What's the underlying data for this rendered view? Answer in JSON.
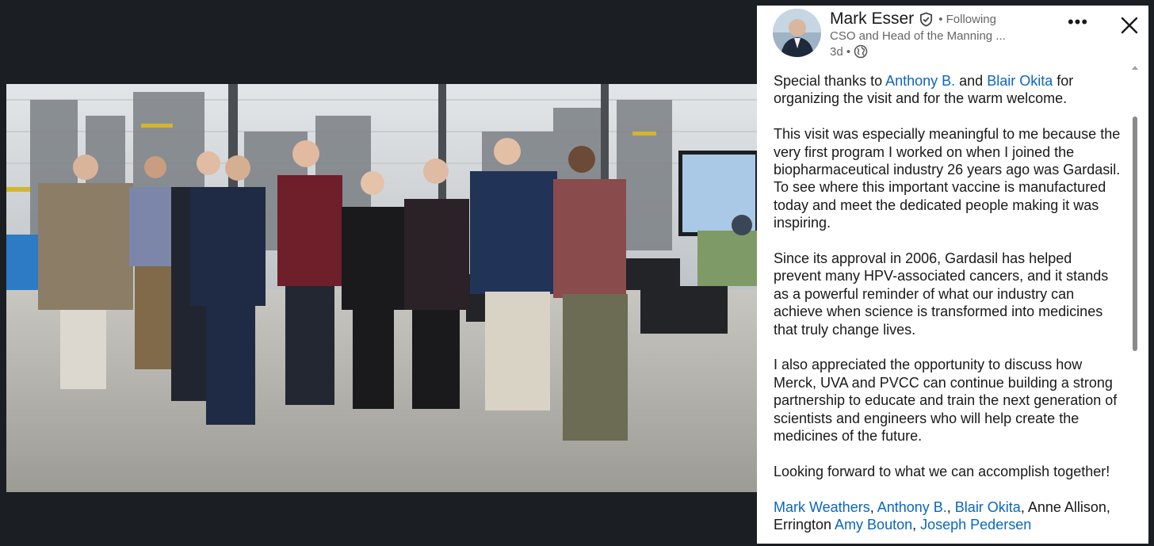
{
  "post": {
    "author": {
      "name": "Mark Esser",
      "following": "• Following",
      "headline": "CSO and Head of the Manning ...",
      "time": "3d •"
    },
    "icons": {
      "verified": "verified-shield-icon",
      "visibility": "globe-icon",
      "more": "more-options-icon",
      "close": "close-icon"
    },
    "body": {
      "p1": {
        "lead": " Special thanks to ",
        "mention1": "Anthony B.",
        "mid": " and ",
        "mention2": "Blair Okita",
        "tail": " for organizing the visit and for the warm welcome."
      },
      "p2": "This visit was especially meaningful to me because the very first program I worked on when I joined the biopharmaceutical industry 26 years ago was Gardasil. To see where this important vaccine is manufactured today and meet the dedicated people making it was inspiring.",
      "p3": "Since its approval in 2006, Gardasil has helped prevent many HPV-associated cancers, and it stands as a powerful reminder of what our industry can achieve when science is transformed into medicines that truly change lives.",
      "p4": "I also appreciated the opportunity to discuss how Merck, UVA and PVCC can continue building a strong partnership to educate and train the next generation of scientists and engineers who will help create the medicines of the future.",
      "p5": "Looking forward to what we can accomplish together!",
      "tags": {
        "t1": "Mark Weathers",
        "sep1": ", ",
        "t2": "Anthony B.",
        "sep2": ", ",
        "t3": "Blair Okita",
        "plain": ", Anne Allison, Errington ",
        "t4": "Amy Bouton",
        "sep3": ", ",
        "t5": "Joseph Pedersen"
      }
    }
  },
  "colors": {
    "link": "#0a66c2",
    "text": "#191919",
    "muted": "#666666",
    "background": "#1b1e22"
  }
}
